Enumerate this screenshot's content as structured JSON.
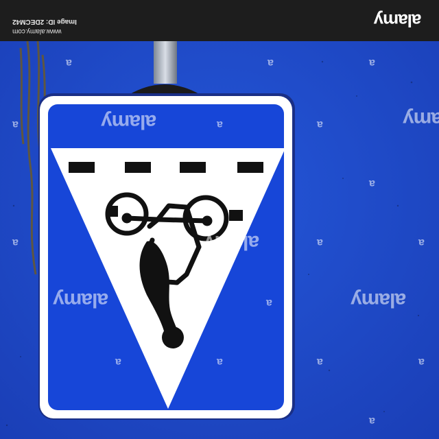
{
  "banner": {
    "site": "www.alamy.com",
    "image_id": "Image ID: 2DECM42",
    "logo": "alamy"
  },
  "watermark": {
    "logo": "alamy",
    "glyph": "a"
  },
  "colors": {
    "sky": "#1f47c9",
    "sign_blue": "#1746d8",
    "sign_white": "#ffffff",
    "symbol_black": "#111111",
    "banner_bg": "#1d1d1d"
  }
}
